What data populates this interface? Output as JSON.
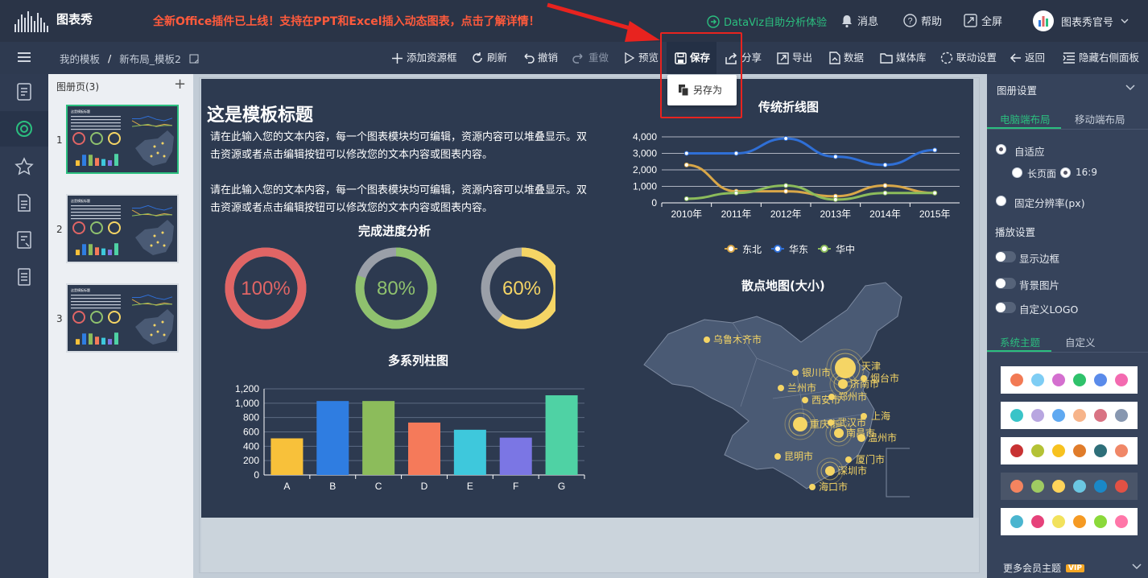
{
  "app": {
    "logo_text": "图表秀",
    "banner": "全新Office插件已上线！支持在PPT和Excel插入动态图表，点击了解详情！",
    "dataviz": "DataViz自助分析体验",
    "messages": "消息",
    "help": "帮助",
    "fullscreen": "全屏",
    "user": "图表秀官号"
  },
  "breadcrumb": {
    "root": "我的模板",
    "sep": "/",
    "current": "新布局_模板2"
  },
  "toolbar": {
    "add": "添加资源框",
    "refresh": "刷新",
    "undo": "撤销",
    "redo": "重做",
    "preview": "预览",
    "save": "保存",
    "share": "分享",
    "export": "导出",
    "data": "数据",
    "media": "媒体库",
    "link": "联动设置",
    "back": "返回",
    "hide_panel": "隐藏右侧面板"
  },
  "save_menu": {
    "save_as": "另存为"
  },
  "pages": {
    "header": "图册页(3)",
    "add": "+",
    "items": [
      "1",
      "2",
      "3"
    ]
  },
  "canvas": {
    "title": "这是模板标题",
    "para1": "请在此输入您的文本内容，每一个图表模块均可编辑，资源内容可以堆叠显示。双击资源或者点击编辑按钮可以修改您的文本内容或图表内容。",
    "para2": "请在此输入您的文本内容，每一个图表模块均可编辑，资源内容可以堆叠显示。双击资源或者点击编辑按钮可以修改您的文本内容或图表内容。",
    "progress_title": "完成进度分析",
    "bar_title": "多系列柱图",
    "line_title": "传统折线图",
    "map_title": "散点地图(大小)"
  },
  "colors": {
    "accent": "#2bbf7f",
    "banner": "#ff5a3c",
    "highlight": "#e8231f"
  },
  "chart_data": [
    {
      "type": "donut",
      "values": [
        100,
        80,
        60
      ],
      "labels": [
        "100%",
        "80%",
        "60%"
      ],
      "colors": [
        "#e06565",
        "#8fc16e",
        "#f5d565"
      ]
    },
    {
      "type": "bar",
      "title": "多系列柱图",
      "categories": [
        "A",
        "B",
        "C",
        "D",
        "E",
        "F",
        "G"
      ],
      "values": [
        510,
        1030,
        1030,
        730,
        630,
        520,
        1110
      ],
      "ylim": [
        0,
        1200
      ],
      "yticks": [
        "0",
        "200",
        "400",
        "600",
        "800",
        "1,000",
        "1,200"
      ],
      "colors": [
        "#f8c13a",
        "#2f7de1",
        "#8cbc5b",
        "#f57a5a",
        "#3ec8dc",
        "#7b76e4",
        "#4fd2a4"
      ]
    },
    {
      "type": "line",
      "title": "传统折线图",
      "categories": [
        "2010年",
        "2011年",
        "2012年",
        "2013年",
        "2014年",
        "2015年"
      ],
      "ylim": [
        0,
        4000
      ],
      "yticks": [
        "0",
        "1,000",
        "2,000",
        "3,000",
        "4,000"
      ],
      "legend": "bottom",
      "series": [
        {
          "name": "东北",
          "color": "#d9a748",
          "values": [
            2300,
            700,
            700,
            400,
            1050,
            600
          ]
        },
        {
          "name": "华东",
          "color": "#2f6fd6",
          "values": [
            3000,
            3000,
            3900,
            2800,
            2300,
            3200
          ]
        },
        {
          "name": "华中",
          "color": "#8cbc5b",
          "values": [
            250,
            600,
            1050,
            200,
            600,
            600
          ]
        }
      ]
    },
    {
      "type": "map-scatter",
      "title": "散点地图(大小)",
      "cities": [
        "乌鲁木齐市",
        "银川市",
        "兰州市",
        "西安市",
        "天津",
        "烟台市",
        "济南市",
        "郑州市",
        "上海",
        "重庆市",
        "武汉市",
        "南昌市",
        "温州市",
        "昆明市",
        "厦门市",
        "深圳市",
        "海口市"
      ]
    }
  ],
  "right_panel": {
    "settings": "图册设置",
    "tab_pc": "电脑端布局",
    "tab_mobile": "移动端布局",
    "adaptive": "自适应",
    "long_page": "长页面",
    "ratio": "16:9",
    "fixed": "固定分辨率(px)",
    "playback": "播放设置",
    "show_border": "显示边框",
    "bg_image": "背景图片",
    "custom_logo": "自定义LOGO",
    "tab_system": "系统主题",
    "tab_custom": "自定义",
    "more_themes": "更多会员主题",
    "vip": "VIP",
    "themes": [
      [
        "#f27a54",
        "#7ecdf4",
        "#d46fcf",
        "#2fc26b",
        "#5a8bea",
        "#f36ab0"
      ],
      [
        "#39c4c8",
        "#b8a6e0",
        "#5fa9f1",
        "#f7b48a",
        "#d97383",
        "#8797b0"
      ],
      [
        "#c83233",
        "#b4c235",
        "#f7c21f",
        "#e07c2a",
        "#2e6f79",
        "#f08767"
      ],
      [
        "#f4845f",
        "#9fcb62",
        "#ffd45a",
        "#6bc7e2",
        "#1a88c7",
        "#e25144"
      ],
      [
        "#4ab5cf",
        "#e6427a",
        "#f2e25c",
        "#f59a23",
        "#8bd93a",
        "#ff76a8"
      ]
    ]
  }
}
